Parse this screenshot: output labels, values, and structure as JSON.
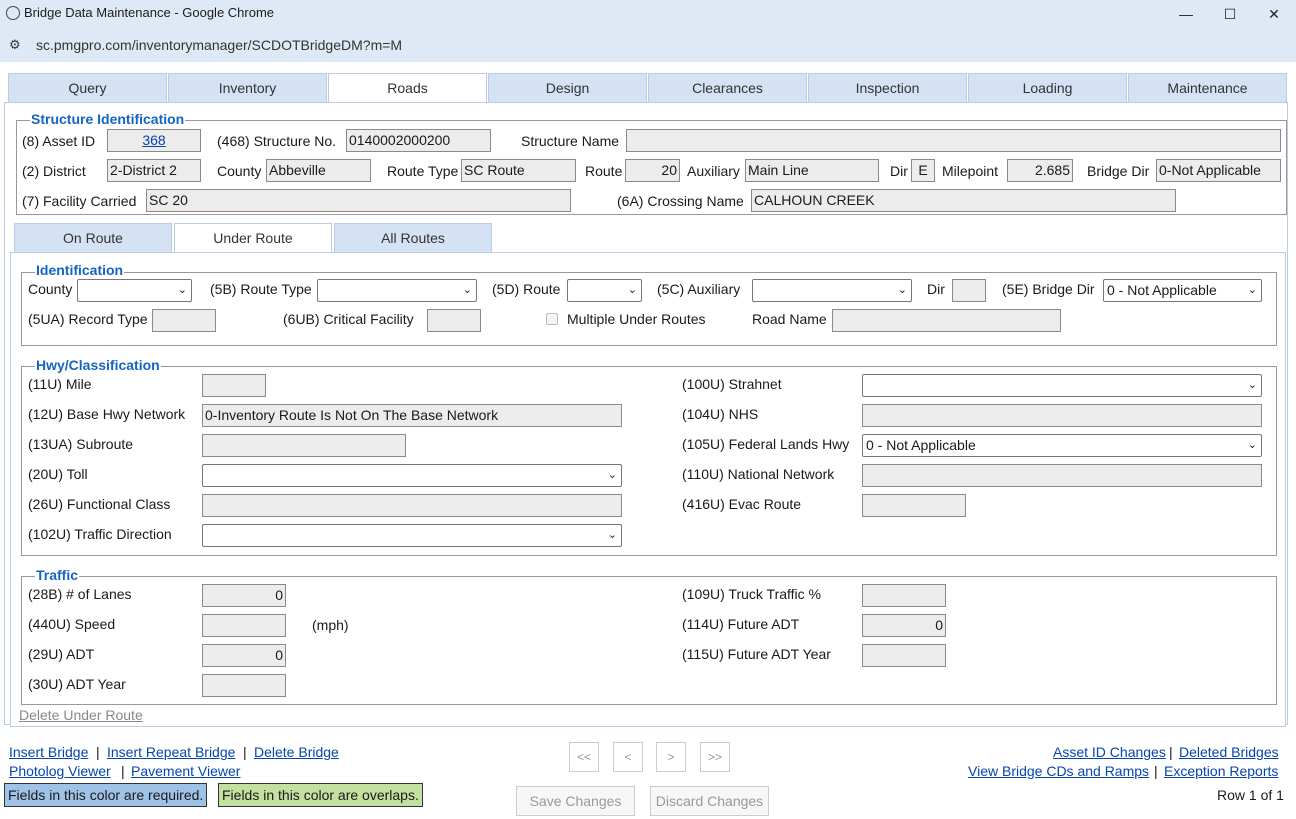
{
  "window": {
    "title": "Bridge Data Maintenance - Google Chrome",
    "url": "sc.pmgpro.com/inventorymanager/SCDOTBridgeDM?m=M"
  },
  "tabs": [
    "Query",
    "Inventory",
    "Roads",
    "Design",
    "Clearances",
    "Inspection",
    "Loading",
    "Maintenance"
  ],
  "active_tab": "Roads",
  "structure_identification": {
    "legend": "Structure Identification",
    "asset_id_label": "(8) Asset ID",
    "asset_id": "368",
    "structure_no_label": "(468) Structure No.",
    "structure_no": "0140002000200",
    "structure_name_label": "Structure Name",
    "structure_name": "",
    "district_label": "(2) District",
    "district": "2-District 2",
    "county_label": "County",
    "county": "Abbeville",
    "route_type_label": "Route Type",
    "route_type": "SC Route",
    "route_label": "Route",
    "route": "20",
    "auxiliary_label": "Auxiliary",
    "auxiliary": "Main Line",
    "dir_label": "Dir",
    "dir": "E",
    "milepoint_label": "Milepoint",
    "milepoint": "2.685",
    "bridge_dir_label": "Bridge Dir",
    "bridge_dir": "0-Not Applicable",
    "facility_carried_label": "(7) Facility Carried",
    "facility_carried": "SC 20",
    "crossing_name_label": "(6A) Crossing Name",
    "crossing_name": "CALHOUN CREEK"
  },
  "sub_tabs": [
    "On Route",
    "Under Route",
    "All Routes"
  ],
  "active_sub_tab": "Under Route",
  "identification": {
    "legend": "Identification",
    "county_label": "County",
    "county": "",
    "route_type_label": "(5B) Route Type",
    "route_type": "",
    "route_label": "(5D) Route",
    "route": "",
    "auxiliary_label": "(5C) Auxiliary",
    "auxiliary": "",
    "dir_label": "Dir",
    "dir": "",
    "bridge_dir_label": "(5E) Bridge Dir",
    "bridge_dir": "0 - Not Applicable",
    "record_type_label": "(5UA) Record Type",
    "record_type": "",
    "critical_facility_label": "(6UB) Critical Facility",
    "critical_facility": "",
    "multiple_under_routes_label": "Multiple Under Routes",
    "road_name_label": "Road Name",
    "road_name": ""
  },
  "hwy": {
    "legend": "Hwy/Classification",
    "mile_label": "(11U) Mile",
    "base_hwy_label": "(12U) Base Hwy Network",
    "base_hwy": "0-Inventory Route Is Not On The Base Network",
    "subroute_label": "(13UA) Subroute",
    "toll_label": "(20U) Toll",
    "functional_class_label": "(26U) Functional Class",
    "traffic_direction_label": "(102U) Traffic Direction",
    "strahnet_label": "(100U) Strahnet",
    "nhs_label": "(104U) NHS",
    "federal_lands_label": "(105U) Federal Lands Hwy",
    "federal_lands": "0 - Not Applicable",
    "national_network_label": "(110U) National Network",
    "evac_route_label": "(416U) Evac Route"
  },
  "traffic": {
    "legend": "Traffic",
    "lanes_label": "(28B) # of Lanes",
    "lanes": "0",
    "speed_label": "(440U) Speed",
    "speed_unit": "(mph)",
    "adt_label": "(29U) ADT",
    "adt": "0",
    "adt_year_label": "(30U) ADT Year",
    "truck_traffic_label": "(109U) Truck Traffic %",
    "future_adt_label": "(114U) Future ADT",
    "future_adt": "0",
    "future_adt_year_label": "(115U) Future ADT Year"
  },
  "delete_under_route": "Delete Under Route",
  "footer": {
    "insert_bridge": "Insert Bridge",
    "insert_repeat_bridge": "Insert Repeat Bridge",
    "delete_bridge": "Delete Bridge",
    "photolog_viewer": "Photolog Viewer",
    "pavement_viewer": "Pavement Viewer",
    "separator": "|",
    "nav_first": "<<",
    "nav_prev": "<",
    "nav_next": ">",
    "nav_last": ">>",
    "save_changes": "Save Changes",
    "discard_changes": "Discard Changes",
    "asset_id_changes": "Asset ID Changes",
    "deleted_bridges": "Deleted Bridges",
    "view_bridge_cds": "View Bridge CDs and Ramps",
    "exception_reports": "Exception Reports",
    "row_info": "Row 1 of 1",
    "required_legend": "Fields in this color are required.",
    "overlaps_legend": "Fields in this color are overlaps.",
    "required_color": "#9fc3e6",
    "overlaps_color": "#c4e0a0"
  }
}
